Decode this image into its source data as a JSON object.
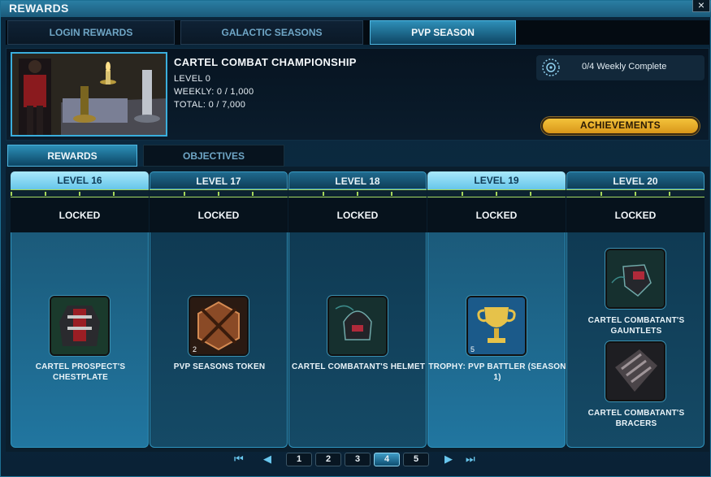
{
  "window": {
    "title": "REWARDS",
    "close_label": "×"
  },
  "top_tabs": [
    {
      "label": "LOGIN REWARDS",
      "active": false
    },
    {
      "label": "GALACTIC SEASONS",
      "active": false
    },
    {
      "label": "PVP SEASON",
      "active": true
    }
  ],
  "header": {
    "title": "CARTEL COMBAT CHAMPIONSHIP",
    "level": "LEVEL 0",
    "weekly": "WEEKLY: 0 / 1,000",
    "total": "TOTAL: 0 / 7,000",
    "weekly_complete": "0/4 Weekly Complete",
    "achievements_label": "ACHIEVEMENTS"
  },
  "sub_tabs": [
    {
      "label": "REWARDS",
      "active": true
    },
    {
      "label": "OBJECTIVES",
      "active": false
    }
  ],
  "columns": [
    {
      "level": "LEVEL 16",
      "status": "LOCKED",
      "highlight": true,
      "items": [
        {
          "name": "CARTEL PROSPECT'S CHESTPLATE",
          "count": "",
          "icon": "chestplate-icon"
        }
      ]
    },
    {
      "level": "LEVEL 17",
      "status": "LOCKED",
      "highlight": false,
      "items": [
        {
          "name": "PVP SEASONS TOKEN",
          "count": "2",
          "icon": "token-icon"
        }
      ]
    },
    {
      "level": "LEVEL 18",
      "status": "LOCKED",
      "highlight": false,
      "items": [
        {
          "name": "CARTEL COMBATANT'S HELMET",
          "count": "",
          "icon": "helmet-icon"
        }
      ]
    },
    {
      "level": "LEVEL 19",
      "status": "LOCKED",
      "highlight": true,
      "items": [
        {
          "name": "TROPHY: PVP BATTLER (SEASON 1)",
          "count": "5",
          "icon": "trophy-icon"
        }
      ]
    },
    {
      "level": "LEVEL 20",
      "status": "LOCKED",
      "highlight": false,
      "items": [
        {
          "name": "CARTEL COMBATANT'S GAUNTLETS",
          "count": "",
          "icon": "gauntlets-icon"
        },
        {
          "name": "CARTEL COMBATANT'S BRACERS",
          "count": "",
          "icon": "bracers-icon"
        }
      ]
    }
  ],
  "pager": {
    "pages": [
      "1",
      "2",
      "3",
      "4",
      "5"
    ],
    "current": "4"
  },
  "colors": {
    "accent": "#4fb6e0",
    "achievement_gold": "#f3c23a",
    "progress_green": "#a6d65a"
  }
}
